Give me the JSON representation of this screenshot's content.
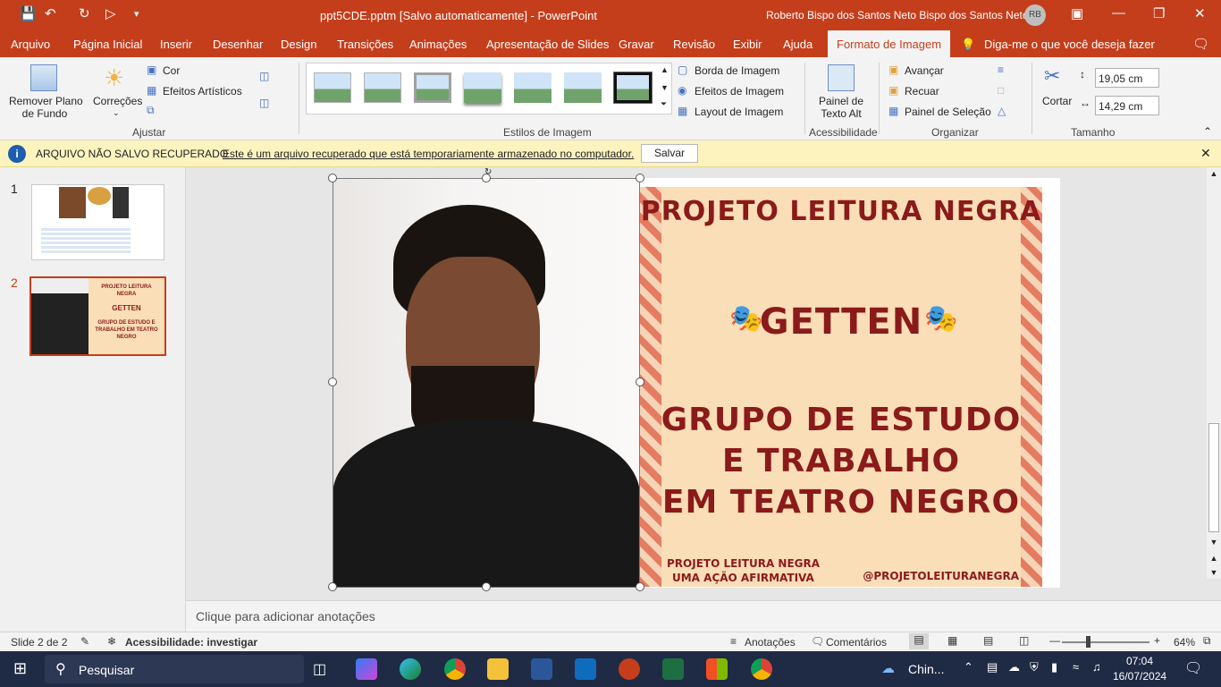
{
  "titlebar": {
    "title": "ppt5CDE.pptm [Salvo automaticamente]  -  PowerPoint",
    "user": "Roberto Bispo dos Santos Neto Bispo dos Santos Neto",
    "avatar": "RB"
  },
  "menu": [
    "Arquivo",
    "Página Inicial",
    "Inserir",
    "Desenhar",
    "Design",
    "Transições",
    "Animações",
    "Apresentação de Slides",
    "Gravar",
    "Revisão",
    "Exibir",
    "Ajuda",
    "Formato de Imagem"
  ],
  "tellme": "Diga-me o que você deseja fazer",
  "ribbon": {
    "remove_bg": [
      "Remover Plano",
      "de Fundo"
    ],
    "corrections": "Correções",
    "color": "Cor",
    "artistic": "Efeitos Artísticos",
    "group_adjust": "Ajustar",
    "group_styles": "Estilos de Imagem",
    "border": "Borda de Imagem",
    "effects": "Efeitos de Imagem",
    "layout": "Layout de Imagem",
    "alt_text": [
      "Painel de",
      "Texto Alt"
    ],
    "group_access": "Acessibilidade",
    "forward": "Avançar",
    "backward": "Recuar",
    "selection": "Painel de Seleção",
    "group_arrange": "Organizar",
    "crop": "Cortar",
    "height": "19,05 cm",
    "width": "14,29 cm",
    "group_size": "Tamanho"
  },
  "infobar": {
    "title": "ARQUIVO NÃO SALVO RECUPERADO",
    "message": "Este é um arquivo recuperado que está temporariamente armazenado no computador.",
    "button": "Salvar"
  },
  "thumbnails": {
    "n1": "1",
    "n2": "2",
    "t2_line1": "PROJETO LEITURA NEGRA",
    "t2_line2": "GETTEN",
    "t2_line3": "GRUPO DE ESTUDO E TRABALHO EM TEATRO NEGRO"
  },
  "slide": {
    "headline": "PROJETO LEITURA NEGRA",
    "getten": "GETTEN",
    "line1": "GRUPO DE ESTUDO",
    "line2": "E TRABALHO",
    "line3": "EM TEATRO NEGRO",
    "foot_left1": "PROJETO LEITURA NEGRA",
    "foot_left2": "UMA AÇÃO AFIRMATIVA",
    "foot_right": "@PROJETOLEITURANEGRA"
  },
  "notes_placeholder": "Clique para adicionar anotações",
  "status": {
    "slide": "Slide 2 de 2",
    "accessibility": "Acessibilidade: investigar",
    "notes": "Anotações",
    "comments": "Comentários",
    "zoom": "64%"
  },
  "taskbar": {
    "search": "Pesquisar",
    "weather": "Chin...",
    "time": "07:04",
    "date": "16/07/2024"
  }
}
